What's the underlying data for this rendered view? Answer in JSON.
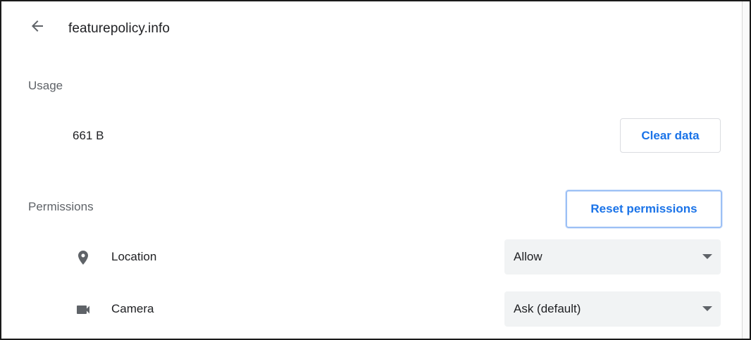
{
  "header": {
    "back_icon": "arrow-left-icon",
    "site": "featurepolicy.info"
  },
  "usage": {
    "heading": "Usage",
    "amount": "661 B",
    "clear_label": "Clear data"
  },
  "permissions": {
    "heading": "Permissions",
    "reset_label": "Reset permissions",
    "items": [
      {
        "icon": "location-pin-icon",
        "label": "Location",
        "value": "Allow"
      },
      {
        "icon": "camera-icon",
        "label": "Camera",
        "value": "Ask (default)"
      }
    ]
  },
  "colors": {
    "accent": "#1a73e8",
    "select_background": "#f1f3f4",
    "secondary_text": "#5f6368",
    "primary_text": "#202124"
  }
}
